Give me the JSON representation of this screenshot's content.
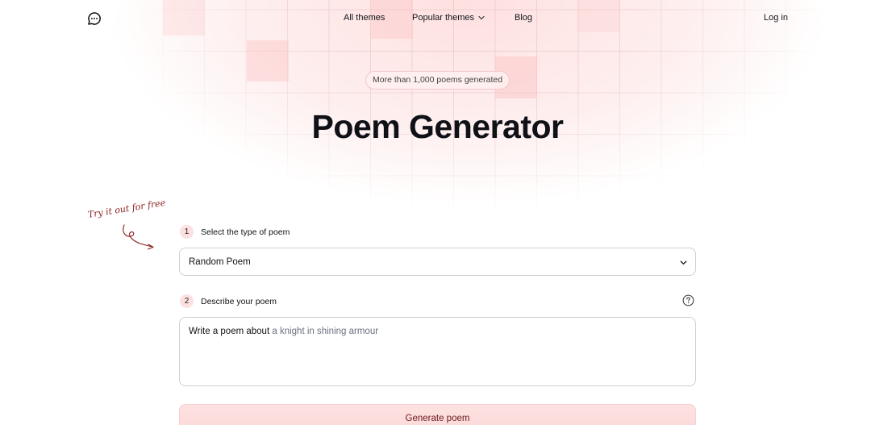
{
  "nav": {
    "logo_icon": "chat-bubble-icon",
    "links": {
      "all_themes": "All themes",
      "popular_themes": "Popular themes",
      "blog": "Blog",
      "login": "Log in"
    }
  },
  "hero": {
    "badge": "More than 1,000 poems generated",
    "title": "Poem Generator"
  },
  "annotation": {
    "text": "Try it out for free"
  },
  "form": {
    "step1": {
      "number": "1",
      "label": "Select the type of poem"
    },
    "poem_type": {
      "selected": "Random Poem"
    },
    "step2": {
      "number": "2",
      "label": "Describe your poem"
    },
    "description": {
      "prefix": "Write a poem about",
      "placeholder": "a knight in shining armour"
    },
    "generate_label": "Generate poem"
  },
  "colors": {
    "accent_light": "#fde0e0",
    "button_text": "#6b1818",
    "annotation": "#8a1e1e"
  }
}
